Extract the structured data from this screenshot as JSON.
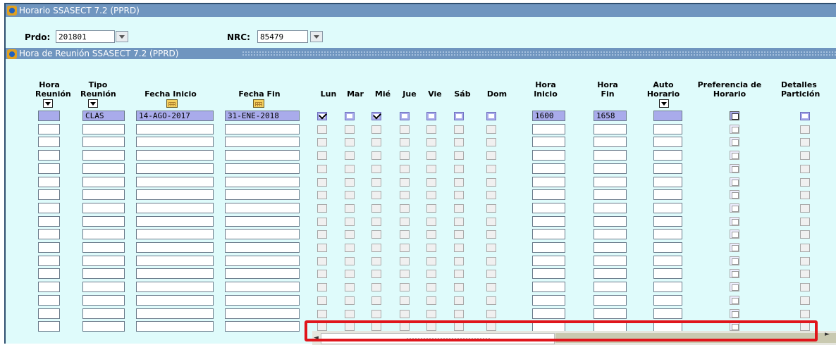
{
  "window": {
    "title": "Horario  SSASECT  7.2  (PPRD)"
  },
  "key_block": {
    "prdo_label": "Prdo:",
    "prdo_value": "201801",
    "nrc_label": "NRC:",
    "nrc_value": "85479"
  },
  "subwindow": {
    "title": "Hora de Reunión  SSASECT  7.2  (PPRD)"
  },
  "columns": {
    "hora_reunion": [
      "Hora",
      "Reunión"
    ],
    "tipo_reunion": [
      "Tipo",
      "Reunión"
    ],
    "fecha_inicio": "Fecha Inicio",
    "fecha_fin": "Fecha Fin",
    "days": [
      "Lun",
      "Mar",
      "Mié",
      "Jue",
      "Vie",
      "Sáb",
      "Dom"
    ],
    "hora_inicio": [
      "Hora",
      "Inicio"
    ],
    "hora_fin": [
      "Hora",
      "Fin"
    ],
    "auto_horario": [
      "Auto",
      "Horario"
    ],
    "preferencia": [
      "Preferencia de",
      "Horario"
    ],
    "detalles": [
      "Detalles",
      "Partición"
    ]
  },
  "rows": [
    {
      "hora_reunion": "",
      "tipo": "CLAS",
      "fecha_inicio": "14-AGO-2017",
      "fecha_fin": "31-ENE-2018",
      "days": [
        true,
        false,
        true,
        false,
        false,
        false,
        false
      ],
      "hora_inicio": "1600",
      "hora_fin": "1658",
      "auto": ""
    }
  ],
  "empty_row_count": 16,
  "icons": {
    "lov": "dropdown-arrow-icon",
    "calendar": "calendar-icon",
    "window": "app-icon",
    "preference": "preference-icon"
  },
  "colors": {
    "title_bar": "#6f95bf",
    "background": "#dffbfb",
    "current_record": "#a9abeb",
    "highlight_box": "#e0151b"
  }
}
